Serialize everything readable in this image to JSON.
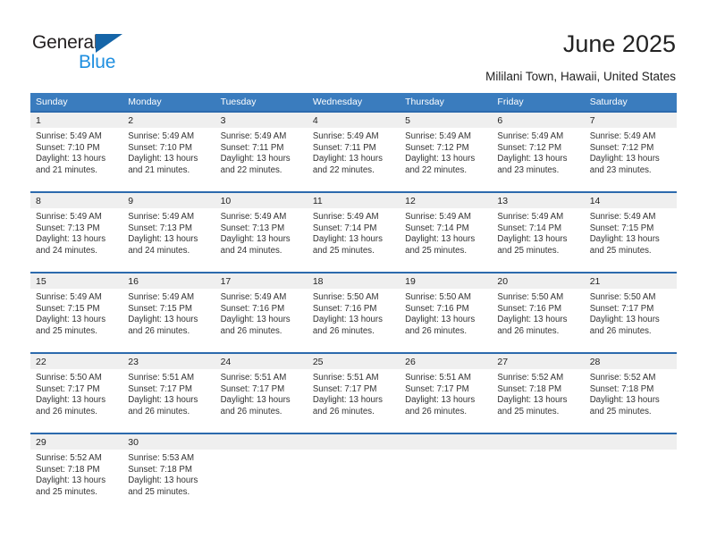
{
  "brand": {
    "name_part1": "General",
    "name_part2": "Blue",
    "triangle_color": "#1565a8",
    "blue_text_color": "#1f8fe0"
  },
  "header": {
    "title": "June 2025",
    "location": "Mililani Town, Hawaii, United States"
  },
  "theme": {
    "header_bar_color": "#3a7cbe",
    "row_rule_color": "#2c6aad",
    "daynum_band_color": "#efefef"
  },
  "weekdays": [
    "Sunday",
    "Monday",
    "Tuesday",
    "Wednesday",
    "Thursday",
    "Friday",
    "Saturday"
  ],
  "weeks": [
    {
      "days": [
        {
          "num": "1",
          "sunrise": "Sunrise: 5:49 AM",
          "sunset": "Sunset: 7:10 PM",
          "daylight": "Daylight: 13 hours and 21 minutes."
        },
        {
          "num": "2",
          "sunrise": "Sunrise: 5:49 AM",
          "sunset": "Sunset: 7:10 PM",
          "daylight": "Daylight: 13 hours and 21 minutes."
        },
        {
          "num": "3",
          "sunrise": "Sunrise: 5:49 AM",
          "sunset": "Sunset: 7:11 PM",
          "daylight": "Daylight: 13 hours and 22 minutes."
        },
        {
          "num": "4",
          "sunrise": "Sunrise: 5:49 AM",
          "sunset": "Sunset: 7:11 PM",
          "daylight": "Daylight: 13 hours and 22 minutes."
        },
        {
          "num": "5",
          "sunrise": "Sunrise: 5:49 AM",
          "sunset": "Sunset: 7:12 PM",
          "daylight": "Daylight: 13 hours and 22 minutes."
        },
        {
          "num": "6",
          "sunrise": "Sunrise: 5:49 AM",
          "sunset": "Sunset: 7:12 PM",
          "daylight": "Daylight: 13 hours and 23 minutes."
        },
        {
          "num": "7",
          "sunrise": "Sunrise: 5:49 AM",
          "sunset": "Sunset: 7:12 PM",
          "daylight": "Daylight: 13 hours and 23 minutes."
        }
      ]
    },
    {
      "days": [
        {
          "num": "8",
          "sunrise": "Sunrise: 5:49 AM",
          "sunset": "Sunset: 7:13 PM",
          "daylight": "Daylight: 13 hours and 24 minutes."
        },
        {
          "num": "9",
          "sunrise": "Sunrise: 5:49 AM",
          "sunset": "Sunset: 7:13 PM",
          "daylight": "Daylight: 13 hours and 24 minutes."
        },
        {
          "num": "10",
          "sunrise": "Sunrise: 5:49 AM",
          "sunset": "Sunset: 7:13 PM",
          "daylight": "Daylight: 13 hours and 24 minutes."
        },
        {
          "num": "11",
          "sunrise": "Sunrise: 5:49 AM",
          "sunset": "Sunset: 7:14 PM",
          "daylight": "Daylight: 13 hours and 25 minutes."
        },
        {
          "num": "12",
          "sunrise": "Sunrise: 5:49 AM",
          "sunset": "Sunset: 7:14 PM",
          "daylight": "Daylight: 13 hours and 25 minutes."
        },
        {
          "num": "13",
          "sunrise": "Sunrise: 5:49 AM",
          "sunset": "Sunset: 7:14 PM",
          "daylight": "Daylight: 13 hours and 25 minutes."
        },
        {
          "num": "14",
          "sunrise": "Sunrise: 5:49 AM",
          "sunset": "Sunset: 7:15 PM",
          "daylight": "Daylight: 13 hours and 25 minutes."
        }
      ]
    },
    {
      "days": [
        {
          "num": "15",
          "sunrise": "Sunrise: 5:49 AM",
          "sunset": "Sunset: 7:15 PM",
          "daylight": "Daylight: 13 hours and 25 minutes."
        },
        {
          "num": "16",
          "sunrise": "Sunrise: 5:49 AM",
          "sunset": "Sunset: 7:15 PM",
          "daylight": "Daylight: 13 hours and 26 minutes."
        },
        {
          "num": "17",
          "sunrise": "Sunrise: 5:49 AM",
          "sunset": "Sunset: 7:16 PM",
          "daylight": "Daylight: 13 hours and 26 minutes."
        },
        {
          "num": "18",
          "sunrise": "Sunrise: 5:50 AM",
          "sunset": "Sunset: 7:16 PM",
          "daylight": "Daylight: 13 hours and 26 minutes."
        },
        {
          "num": "19",
          "sunrise": "Sunrise: 5:50 AM",
          "sunset": "Sunset: 7:16 PM",
          "daylight": "Daylight: 13 hours and 26 minutes."
        },
        {
          "num": "20",
          "sunrise": "Sunrise: 5:50 AM",
          "sunset": "Sunset: 7:16 PM",
          "daylight": "Daylight: 13 hours and 26 minutes."
        },
        {
          "num": "21",
          "sunrise": "Sunrise: 5:50 AM",
          "sunset": "Sunset: 7:17 PM",
          "daylight": "Daylight: 13 hours and 26 minutes."
        }
      ]
    },
    {
      "days": [
        {
          "num": "22",
          "sunrise": "Sunrise: 5:50 AM",
          "sunset": "Sunset: 7:17 PM",
          "daylight": "Daylight: 13 hours and 26 minutes."
        },
        {
          "num": "23",
          "sunrise": "Sunrise: 5:51 AM",
          "sunset": "Sunset: 7:17 PM",
          "daylight": "Daylight: 13 hours and 26 minutes."
        },
        {
          "num": "24",
          "sunrise": "Sunrise: 5:51 AM",
          "sunset": "Sunset: 7:17 PM",
          "daylight": "Daylight: 13 hours and 26 minutes."
        },
        {
          "num": "25",
          "sunrise": "Sunrise: 5:51 AM",
          "sunset": "Sunset: 7:17 PM",
          "daylight": "Daylight: 13 hours and 26 minutes."
        },
        {
          "num": "26",
          "sunrise": "Sunrise: 5:51 AM",
          "sunset": "Sunset: 7:17 PM",
          "daylight": "Daylight: 13 hours and 26 minutes."
        },
        {
          "num": "27",
          "sunrise": "Sunrise: 5:52 AM",
          "sunset": "Sunset: 7:18 PM",
          "daylight": "Daylight: 13 hours and 25 minutes."
        },
        {
          "num": "28",
          "sunrise": "Sunrise: 5:52 AM",
          "sunset": "Sunset: 7:18 PM",
          "daylight": "Daylight: 13 hours and 25 minutes."
        }
      ]
    },
    {
      "days": [
        {
          "num": "29",
          "sunrise": "Sunrise: 5:52 AM",
          "sunset": "Sunset: 7:18 PM",
          "daylight": "Daylight: 13 hours and 25 minutes."
        },
        {
          "num": "30",
          "sunrise": "Sunrise: 5:53 AM",
          "sunset": "Sunset: 7:18 PM",
          "daylight": "Daylight: 13 hours and 25 minutes."
        },
        {
          "num": "",
          "sunrise": "",
          "sunset": "",
          "daylight": ""
        },
        {
          "num": "",
          "sunrise": "",
          "sunset": "",
          "daylight": ""
        },
        {
          "num": "",
          "sunrise": "",
          "sunset": "",
          "daylight": ""
        },
        {
          "num": "",
          "sunrise": "",
          "sunset": "",
          "daylight": ""
        },
        {
          "num": "",
          "sunrise": "",
          "sunset": "",
          "daylight": ""
        }
      ]
    }
  ]
}
